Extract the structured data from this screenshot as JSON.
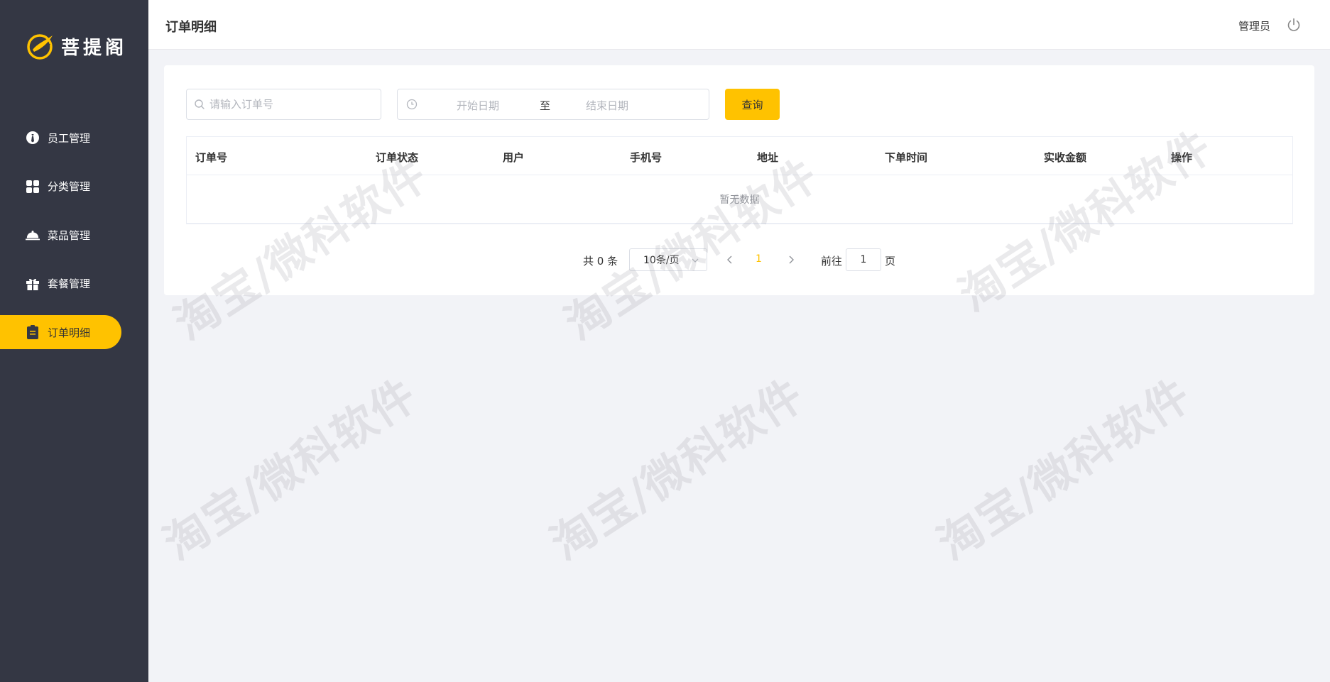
{
  "app": {
    "logo_text": "菩提阁",
    "brand_color": "#ffc200",
    "sidebar_bg": "#343744"
  },
  "sidebar": {
    "items": [
      {
        "label": "员工管理",
        "icon": "staff-icon",
        "active": false
      },
      {
        "label": "分类管理",
        "icon": "category-grid-icon",
        "active": false
      },
      {
        "label": "菜品管理",
        "icon": "dish-cloche-icon",
        "active": false
      },
      {
        "label": "套餐管理",
        "icon": "gift-icon",
        "active": false
      },
      {
        "label": "订单明细",
        "icon": "clipboard-icon",
        "active": true
      }
    ]
  },
  "header": {
    "title": "订单明细",
    "user": "管理员",
    "logout_icon": "power-icon"
  },
  "filters": {
    "order_placeholder": "请输入订单号",
    "order_value": "",
    "start_date_placeholder": "开始日期",
    "date_separator": "至",
    "end_date_placeholder": "结束日期",
    "query_label": "查询"
  },
  "table": {
    "columns": [
      "订单号",
      "订单状态",
      "用户",
      "手机号",
      "地址",
      "下单时间",
      "实收金额",
      "操作"
    ],
    "rows": [],
    "empty_text": "暂无数据"
  },
  "pagination": {
    "total": "共 0 条",
    "page_size": "10条/页",
    "current_page": "1",
    "goto_label": "前往",
    "goto_value": "1",
    "page_suffix": "页"
  },
  "watermark": {
    "text": "淘宝/微科软件"
  }
}
